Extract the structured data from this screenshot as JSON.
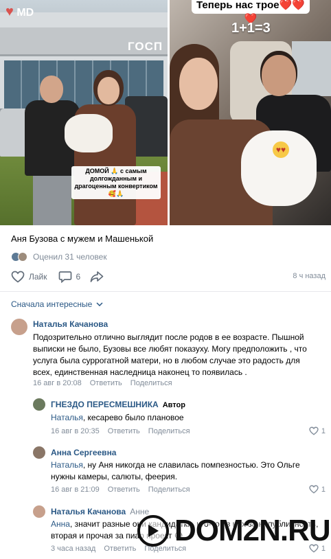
{
  "photos": {
    "left": {
      "logo_text": "MD",
      "sign_text": "ГОСП",
      "caption": "ДОМОЙ 🙏 с самым долгожданным и драгоценным конвертиком 🥰🙏"
    },
    "right": {
      "caption_top": "Теперь нас трое",
      "caption_hearts": "❤️❤️❤️",
      "caption_sum": "1+1=3"
    }
  },
  "post": {
    "title": "Аня Бузова с мужем и Машенькой",
    "rated_text": "Оценил 31 человек",
    "like_label": "Лайк",
    "comments_count": "6",
    "time": "8 ч назад"
  },
  "sort_label": "Сначала интересные",
  "comments": [
    {
      "author": "Наталья Качанова",
      "text": "Подозрительно отлично выглядит после родов в ее возрасте. Пышной выписки не было, Бузовы все любят показуху. Могу предположить , что услуга была суррогатной матери, но в любом случае это радость для всех, единственная наследница наконец то появилась .",
      "date": "16 авг в 20:08",
      "reply_label": "Ответить",
      "share_label": "Поделиться",
      "avatar_color": "#c7a08c"
    },
    {
      "author": "ГНЕЗДО ПЕРЕСМЕШНИКА",
      "role": "Автор",
      "mention": "Наталья",
      "text": ", кесарево было плановое",
      "date": "16 авг в 20:35",
      "reply_label": "Ответить",
      "share_label": "Поделиться",
      "likes": "1",
      "avatar_color": "#6b7a5e"
    },
    {
      "author": "Анна Сергеевна",
      "mention": "Наталья",
      "text": ", ну Аня никогда не славилась помпезностью. Это Ольге нужны камеры, салюты, феерия.",
      "date": "16 авг в 21:09",
      "reply_label": "Ответить",
      "share_label": "Поделиться",
      "likes": "1",
      "avatar_color": "#8a7667"
    },
    {
      "author": "Наталья Качанова",
      "reply_to": "Анне",
      "mention": "Анна",
      "text": ", значит разные они кандидатки, кто-то из них за непубличность, вторая и прочая за пиар проект 😅",
      "date": "3 часа назад",
      "reply_label": "Ответить",
      "share_label": "Поделиться",
      "likes": "1",
      "avatar_color": "#c7a08c"
    }
  ],
  "watermark": "DOM2N.RU",
  "colors": {
    "link": "#2a5885",
    "secondary": "#818c99",
    "icon": "#626d7a"
  }
}
